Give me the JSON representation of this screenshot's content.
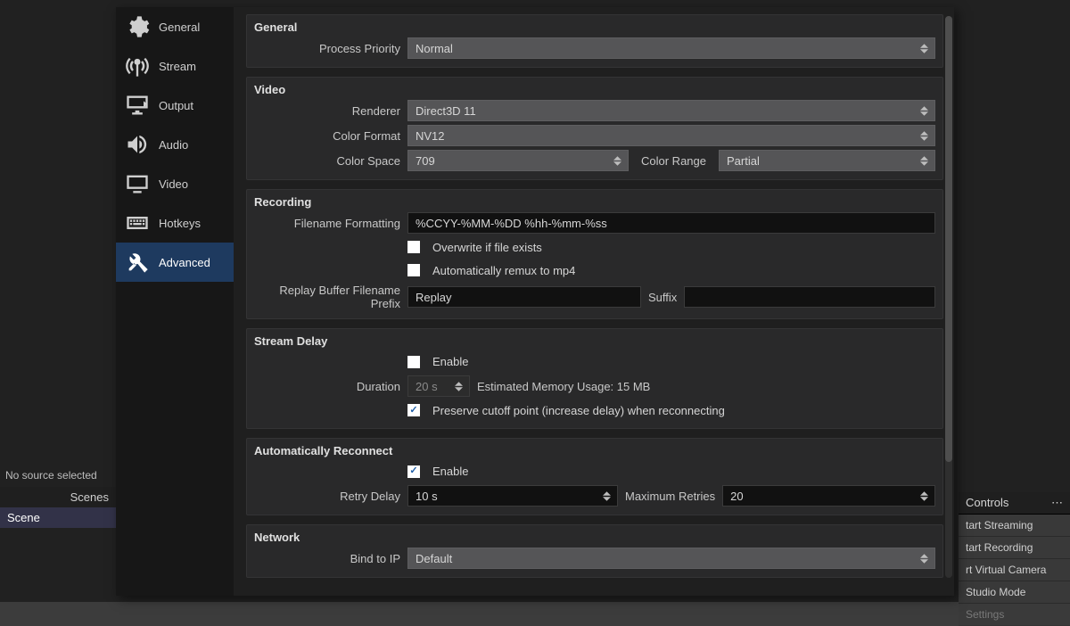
{
  "bgLeft": {
    "noSource": "No source selected",
    "scenesHeader": "Scenes",
    "scene": "Scene"
  },
  "bgRight": {
    "header": "Controls",
    "startStreaming": "tart Streaming",
    "startRecording": "tart Recording",
    "startVirtualCam": "rt Virtual Camera",
    "studioMode": "Studio Mode",
    "settings": "Settings"
  },
  "nav": {
    "general": "General",
    "stream": "Stream",
    "output": "Output",
    "audio": "Audio",
    "video": "Video",
    "hotkeys": "Hotkeys",
    "advanced": "Advanced"
  },
  "general": {
    "title": "General",
    "processPriorityLabel": "Process Priority",
    "processPriority": "Normal"
  },
  "video": {
    "title": "Video",
    "rendererLabel": "Renderer",
    "renderer": "Direct3D 11",
    "colorFormatLabel": "Color Format",
    "colorFormat": "NV12",
    "colorSpaceLabel": "Color Space",
    "colorSpace": "709",
    "colorRangeLabel": "Color Range",
    "colorRange": "Partial"
  },
  "recording": {
    "title": "Recording",
    "filenameFormattingLabel": "Filename Formatting",
    "filenameFormatting": "%CCYY-%MM-%DD %hh-%mm-%ss",
    "overwrite": "Overwrite if file exists",
    "remux": "Automatically remux to mp4",
    "replayPrefixLabel": "Replay Buffer Filename Prefix",
    "replayPrefix": "Replay",
    "suffixLabel": "Suffix",
    "suffix": ""
  },
  "streamDelay": {
    "title": "Stream Delay",
    "enable": "Enable",
    "durationLabel": "Duration",
    "duration": "20 s",
    "memUsage": "Estimated Memory Usage: 15 MB",
    "preserve": "Preserve cutoff point (increase delay) when reconnecting"
  },
  "reconnect": {
    "title": "Automatically Reconnect",
    "enable": "Enable",
    "retryDelayLabel": "Retry Delay",
    "retryDelay": "10 s",
    "maxRetriesLabel": "Maximum Retries",
    "maxRetries": "20"
  },
  "network": {
    "title": "Network",
    "bindLabel": "Bind to IP",
    "bind": "Default"
  }
}
